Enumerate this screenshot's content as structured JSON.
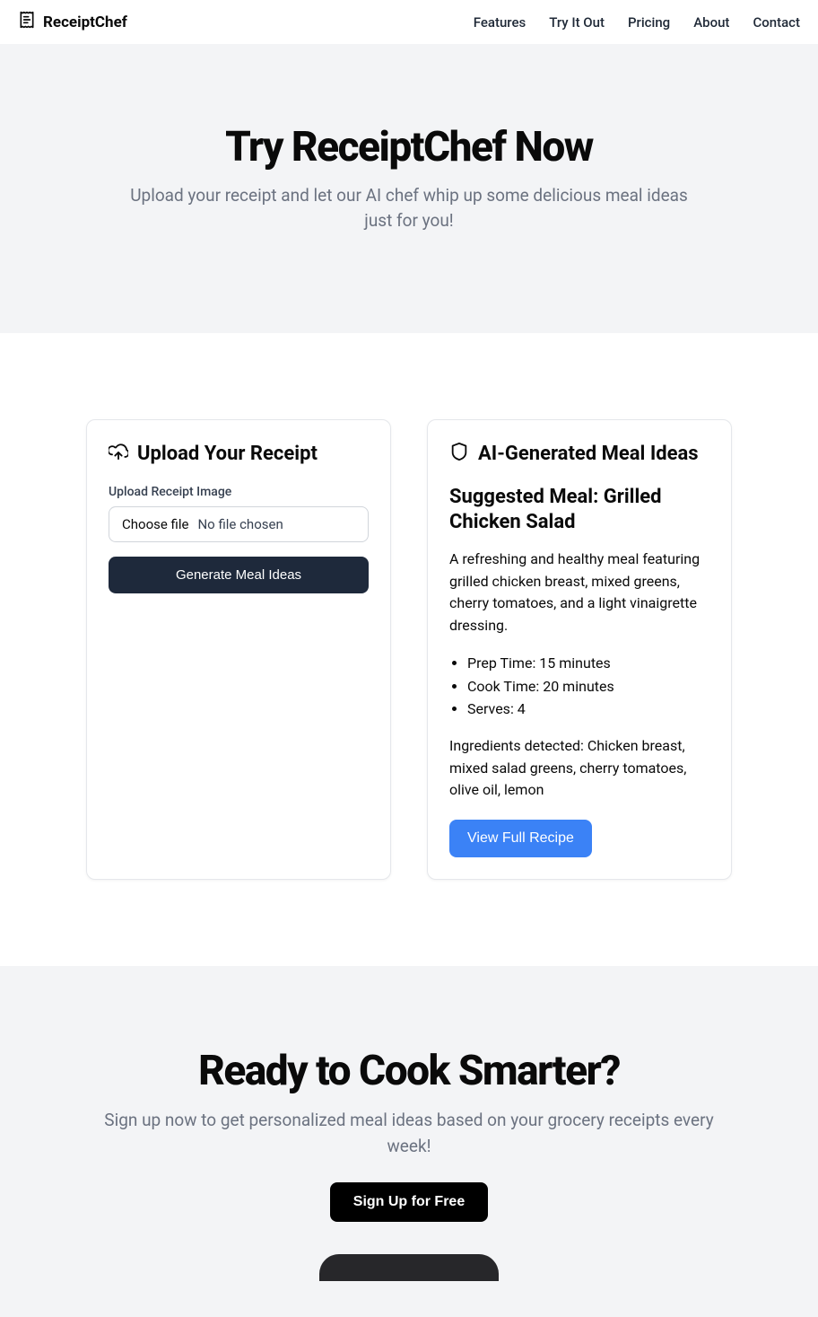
{
  "header": {
    "brand": "ReceiptChef",
    "nav": {
      "features": "Features",
      "try": "Try It Out",
      "pricing": "Pricing",
      "about": "About",
      "contact": "Contact"
    }
  },
  "hero": {
    "title": "Try ReceiptChef Now",
    "subtitle": "Upload your receipt and let our AI chef whip up some delicious meal ideas just for you!"
  },
  "upload": {
    "card_title": "Upload Your Receipt",
    "label": "Upload Receipt Image",
    "choose": "Choose file",
    "none": "No file chosen",
    "button": "Generate Meal Ideas"
  },
  "meal": {
    "card_title": "AI-Generated Meal Ideas",
    "suggested_title": "Suggested Meal: Grilled Chicken Salad",
    "description": "A refreshing and healthy meal featuring grilled chicken breast, mixed greens, cherry tomatoes, and a light vinaigrette dressing.",
    "prep": "Prep Time: 15 minutes",
    "cook": "Cook Time: 20 minutes",
    "serves": "Serves: 4",
    "ingredients": "Ingredients detected: Chicken breast, mixed salad greens, cherry tomatoes, olive oil, lemon",
    "view_button": "View Full Recipe"
  },
  "cta": {
    "title": "Ready to Cook Smarter?",
    "subtitle": "Sign up now to get personalized meal ideas based on your grocery receipts every week!",
    "button": "Sign Up for Free"
  }
}
